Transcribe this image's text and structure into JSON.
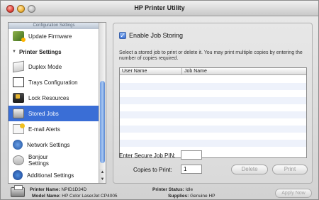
{
  "window": {
    "title": "HP Printer Utility"
  },
  "sidebar": {
    "header": "Configuration Settings",
    "group": "Printer Settings",
    "items": [
      {
        "label": "Update Firmware",
        "icon": "firmware-icon"
      },
      {
        "label": "Duplex Mode",
        "icon": "duplex-icon"
      },
      {
        "label": "Trays Configuration",
        "icon": "trays-icon"
      },
      {
        "label": "Lock Resources",
        "icon": "lock-icon"
      },
      {
        "label": "Stored Jobs",
        "icon": "stored-jobs-icon",
        "selected": true
      },
      {
        "label": "E-mail Alerts",
        "icon": "email-icon"
      },
      {
        "label": "Network Settings",
        "icon": "network-icon"
      },
      {
        "label": "Bonjour Settings",
        "icon": "bonjour-icon"
      },
      {
        "label": "Additional Settings",
        "icon": "additional-settings-icon"
      }
    ]
  },
  "main": {
    "enable_label": "Enable Job Storing",
    "enable_checked": true,
    "description": "Select a stored job to print or delete it.  You may print multiple copies by entering the number of copies required.",
    "table": {
      "columns": [
        "User Name",
        "Job Name"
      ],
      "rows": []
    },
    "pin_label": "Enter Secure Job PIN:",
    "pin_value": "",
    "copies_label": "Copies to Print:",
    "copies_value": "1",
    "delete_label": "Delete",
    "print_label": "Print"
  },
  "footer": {
    "printer_name_label": "Printer Name:",
    "printer_name": "NPID1D34D",
    "model_name_label": "Model Name:",
    "model_name": "HP Color LaserJet CP4005",
    "status_label": "Printer Status:",
    "status": "Idle",
    "supplies_label": "Supplies:",
    "supplies": "Genuine HP",
    "apply_label": "Apply Now"
  },
  "colors": {
    "selection": "#3a6ed6",
    "accent": "#3f74d6"
  }
}
